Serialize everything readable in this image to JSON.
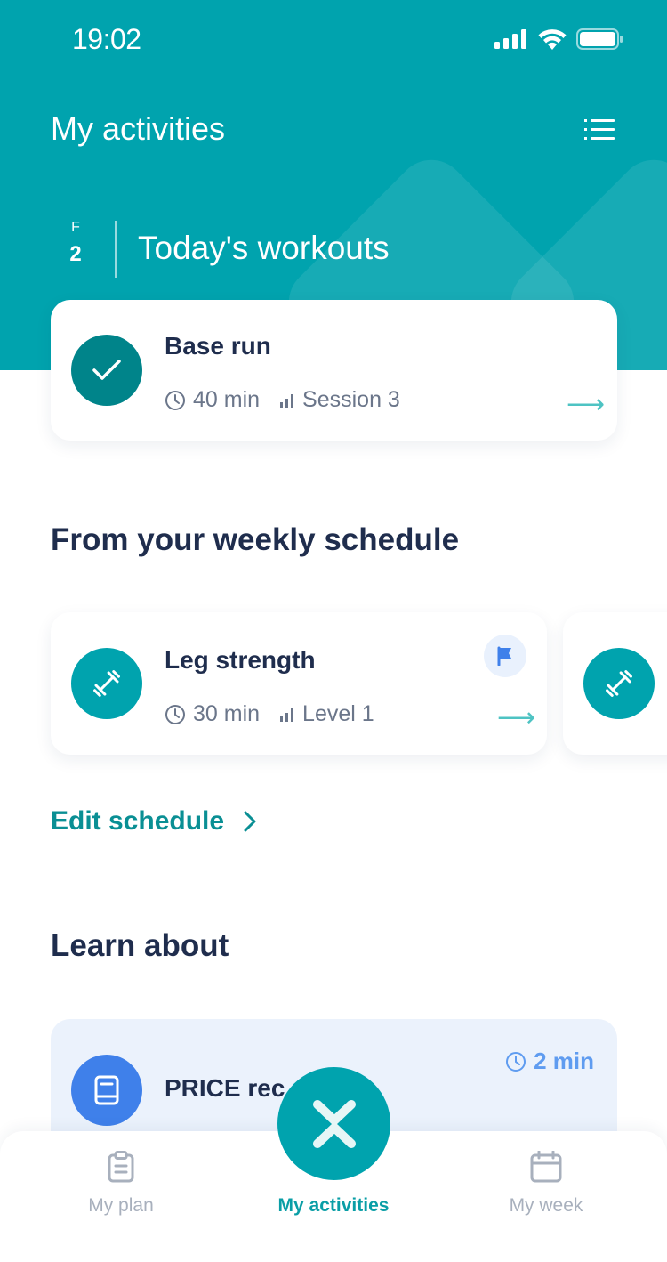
{
  "status_bar": {
    "time": "19:02",
    "icons": [
      "signal-icon",
      "wifi-icon",
      "battery-icon"
    ]
  },
  "header": {
    "title": "My activities",
    "menu_icon": "list-icon"
  },
  "today": {
    "day_of_week": "F",
    "day_number": "2",
    "title": "Today's workouts",
    "workouts": [
      {
        "title": "Base run",
        "duration": "40 min",
        "detail": "Session 3",
        "status": "completed",
        "icon": "check-icon"
      }
    ]
  },
  "schedule": {
    "title": "From your weekly schedule",
    "items": [
      {
        "title": "Leg strength",
        "duration": "30 min",
        "detail": "Level 1",
        "icon": "dumbbell-icon",
        "badge_icon": "flag-icon"
      },
      {
        "title": "",
        "icon": "dumbbell-icon"
      }
    ],
    "edit_label": "Edit schedule"
  },
  "learn": {
    "title": "Learn about",
    "items": [
      {
        "title": "PRICE rec",
        "duration": "2 min",
        "icon": "book-icon"
      }
    ]
  },
  "tabbar": {
    "tabs": [
      {
        "label": "My plan",
        "icon": "clipboard-icon",
        "active": false
      },
      {
        "label": "My activities",
        "icon": "activities-icon",
        "active": true
      },
      {
        "label": "My week",
        "icon": "calendar-icon",
        "active": false
      }
    ]
  },
  "colors": {
    "primary": "#00a3ae",
    "primary_dark": "#00848a",
    "text_dark": "#1f2d4d",
    "text_muted": "#6b768a",
    "link": "#0a8f94",
    "accent_blue": "#3f80ea",
    "learn_bg": "#ebf2fc",
    "tab_inactive": "#a8b0bd"
  }
}
